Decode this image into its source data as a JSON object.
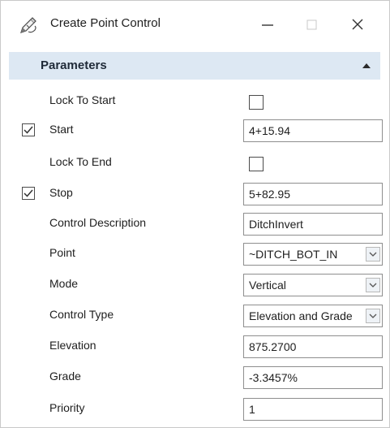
{
  "window": {
    "title": "Create Point Control",
    "icons": {
      "app": "pencil-hand-icon",
      "minimize": "minimize-icon",
      "maximize": "maximize-icon",
      "close": "close-icon"
    }
  },
  "section": {
    "title": "Parameters",
    "collapse_icon": "chevron-up-icon"
  },
  "rows": {
    "lock_to_start": {
      "label": "Lock To Start",
      "checked": false
    },
    "start": {
      "label": "Start",
      "checked": true,
      "value": "4+15.94"
    },
    "lock_to_end": {
      "label": "Lock To End",
      "checked": false
    },
    "stop": {
      "label": "Stop",
      "checked": true,
      "value": "5+82.95"
    },
    "control_description": {
      "label": "Control Description",
      "value": "DitchInvert"
    },
    "point": {
      "label": "Point",
      "value": "~DITCH_BOT_IN"
    },
    "mode": {
      "label": "Mode",
      "value": "Vertical"
    },
    "control_type": {
      "label": "Control Type",
      "value": "Elevation and Grade"
    },
    "elevation": {
      "label": "Elevation",
      "value": "875.2700"
    },
    "grade": {
      "label": "Grade",
      "value": "-3.3457%"
    },
    "priority": {
      "label": "Priority",
      "value": "1"
    }
  },
  "colors": {
    "section_header_bg": "#dde8f3",
    "field_border": "#8e8e8e"
  }
}
